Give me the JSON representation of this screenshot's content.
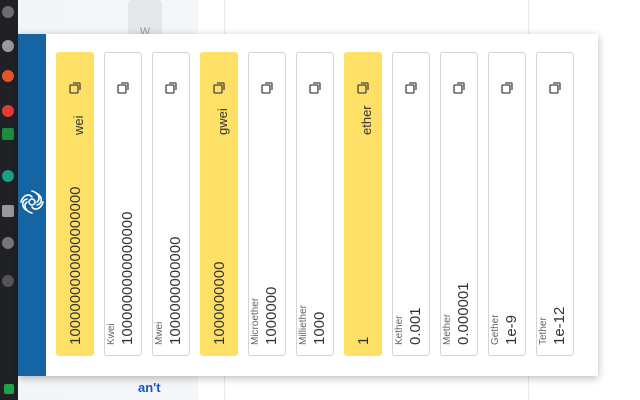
{
  "background": {
    "button_text": "w",
    "link_text": "an't"
  },
  "units": [
    {
      "label": "wei",
      "value": "1000000000000000000",
      "highlight": true,
      "sublabel": ""
    },
    {
      "label": "",
      "value": "1000000000000000",
      "highlight": false,
      "sublabel": "Kwei"
    },
    {
      "label": "",
      "value": "1000000000000",
      "highlight": false,
      "sublabel": "Mwei"
    },
    {
      "label": "gwei",
      "value": "1000000000",
      "highlight": true,
      "sublabel": ""
    },
    {
      "label": "",
      "value": "1000000",
      "highlight": false,
      "sublabel": "Microether"
    },
    {
      "label": "",
      "value": "1000",
      "highlight": false,
      "sublabel": "Milliether"
    },
    {
      "label": "ether",
      "value": "1",
      "highlight": true,
      "sublabel": ""
    },
    {
      "label": "",
      "value": "0.001",
      "highlight": false,
      "sublabel": "Kether"
    },
    {
      "label": "",
      "value": "0.000001",
      "highlight": false,
      "sublabel": "Mether"
    },
    {
      "label": "",
      "value": "1e-9",
      "highlight": false,
      "sublabel": "Gether"
    },
    {
      "label": "",
      "value": "1e-12",
      "highlight": false,
      "sublabel": "Tether"
    }
  ],
  "colors": {
    "brand": "#1565a5",
    "highlight": "#ffe066"
  },
  "icons": {
    "copy": "copy-icon",
    "logo": "ethereum-swirl-logo-icon"
  }
}
